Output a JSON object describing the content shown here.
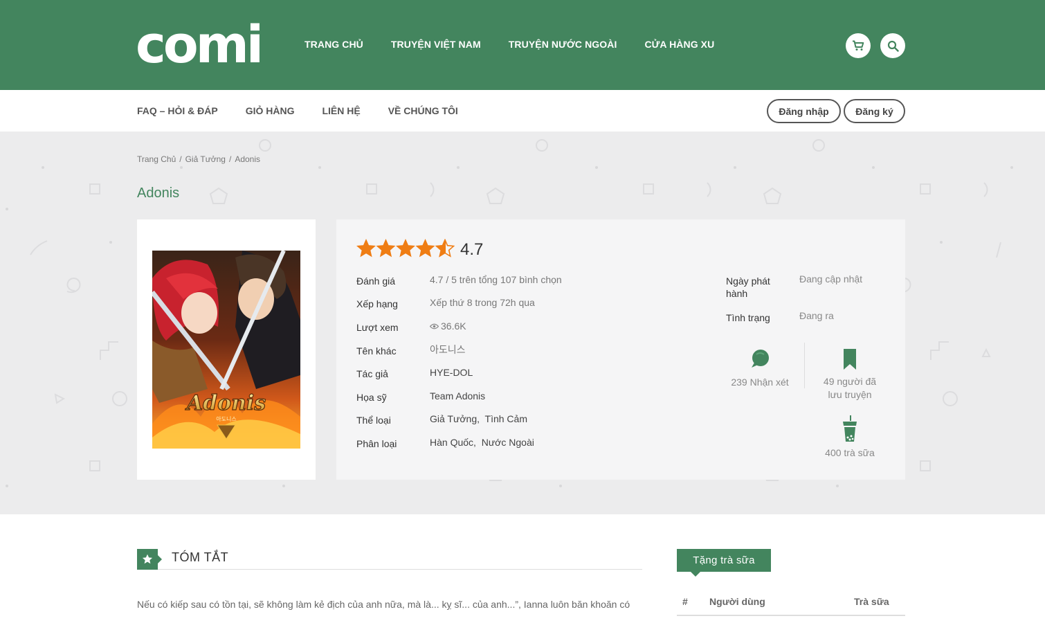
{
  "header": {
    "logo": "comi",
    "nav": [
      "TRANG CHỦ",
      "TRUYỆN VIỆT NAM",
      "TRUYỆN NƯỚC NGOÀI",
      "CỬA HÀNG XU"
    ],
    "cart_icon": "cart-icon",
    "search_icon": "search-icon",
    "brand_color": "#43855e"
  },
  "subnav": {
    "items": [
      "FAQ – HỎI & ĐÁP",
      "GIỎ HÀNG",
      "LIÊN HỆ",
      "VỀ CHÚNG TÔI"
    ],
    "login": "Đăng nhập",
    "register": "Đăng ký"
  },
  "breadcrumb": [
    "Trang Chủ",
    "/",
    "Giả Tưởng",
    "/",
    "Adonis"
  ],
  "comic": {
    "title": "Adonis",
    "cover_text": "Adonis",
    "cover_subtext": "아도니스",
    "rating": "4.7",
    "rating_value": 4.7,
    "rating_max": 5,
    "rows": [
      {
        "label": "Đánh giá",
        "value": "4.7 / 5 trên tổng 107 bình chọn"
      },
      {
        "label": "Xếp hạng",
        "value": "Xếp thứ 8 trong 72h qua"
      },
      {
        "label": "Lượt xem",
        "value": "36.6K"
      },
      {
        "label": "Tên khác",
        "value": "아도니스"
      },
      {
        "label": "Tác giả",
        "value": "HYE-DOL"
      },
      {
        "label": "Họa sỹ",
        "value": "Team Adonis"
      },
      {
        "label": "Thể loại",
        "value": "Giả Tưởng,  Tình Cảm"
      },
      {
        "label": "Phân loại",
        "value": "Hàn Quốc,  Nước Ngoài"
      }
    ],
    "release_label": "Ngày phát hành",
    "release_value": "Đang cập nhật",
    "status_label": "Tình trạng",
    "status_value": "Đang ra",
    "comments": "239 Nhận xét",
    "saved_line1": "49 người đã",
    "saved_line2": "lưu truyện",
    "milktea": "400 trà sữa"
  },
  "summary": {
    "title": "TÓM TẮT",
    "text": "Nếu có kiếp sau có tồn tại, sẽ không làm kẻ địch của anh nữa, mà là... kỵ sĩ... của anh...”, Ianna luôn băn khoăn có"
  },
  "tea": {
    "tab": "Tặng trà sữa",
    "col_index": "#",
    "col_user": "Người dùng",
    "col_tea": "Trà sữa"
  }
}
